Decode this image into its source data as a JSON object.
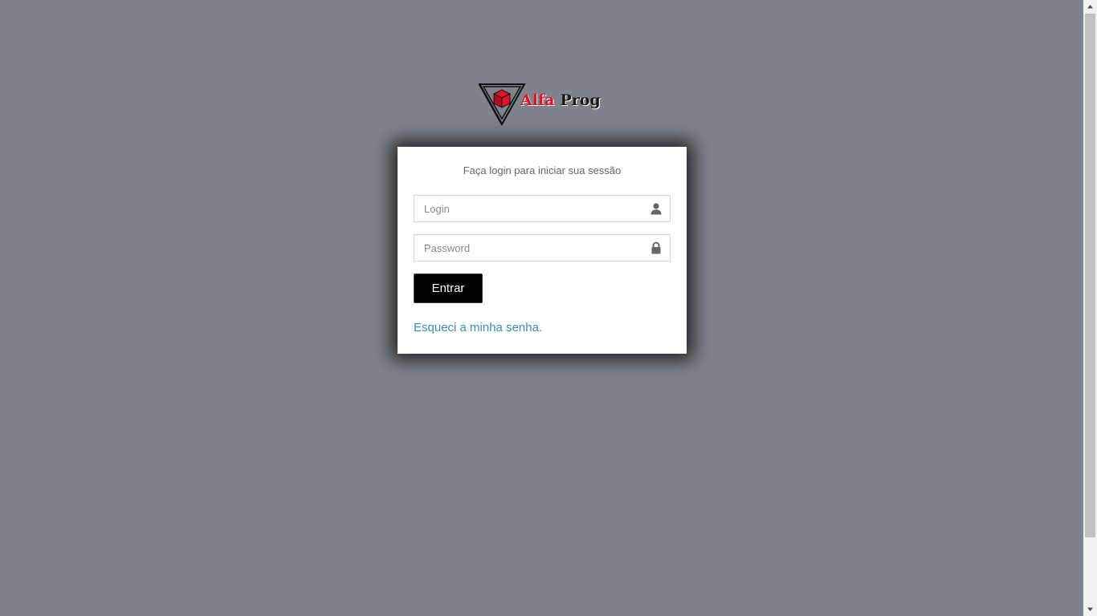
{
  "brand": {
    "word1": "Alfa",
    "word2": "Prog",
    "logo_icon": "triangle-cube-logo-icon",
    "accent_color": "#e3122b"
  },
  "login": {
    "message": "Faça login para iniciar sua sessão",
    "login_placeholder": "Login",
    "login_value": "",
    "login_icon": "user-icon",
    "password_placeholder": "Password",
    "password_value": "",
    "password_icon": "lock-icon",
    "submit_label": "Entrar",
    "forgot_label": "Esqueci a minha senha."
  },
  "colors": {
    "background": "#80838b",
    "button": "#000000",
    "link": "#3c8dbc"
  }
}
